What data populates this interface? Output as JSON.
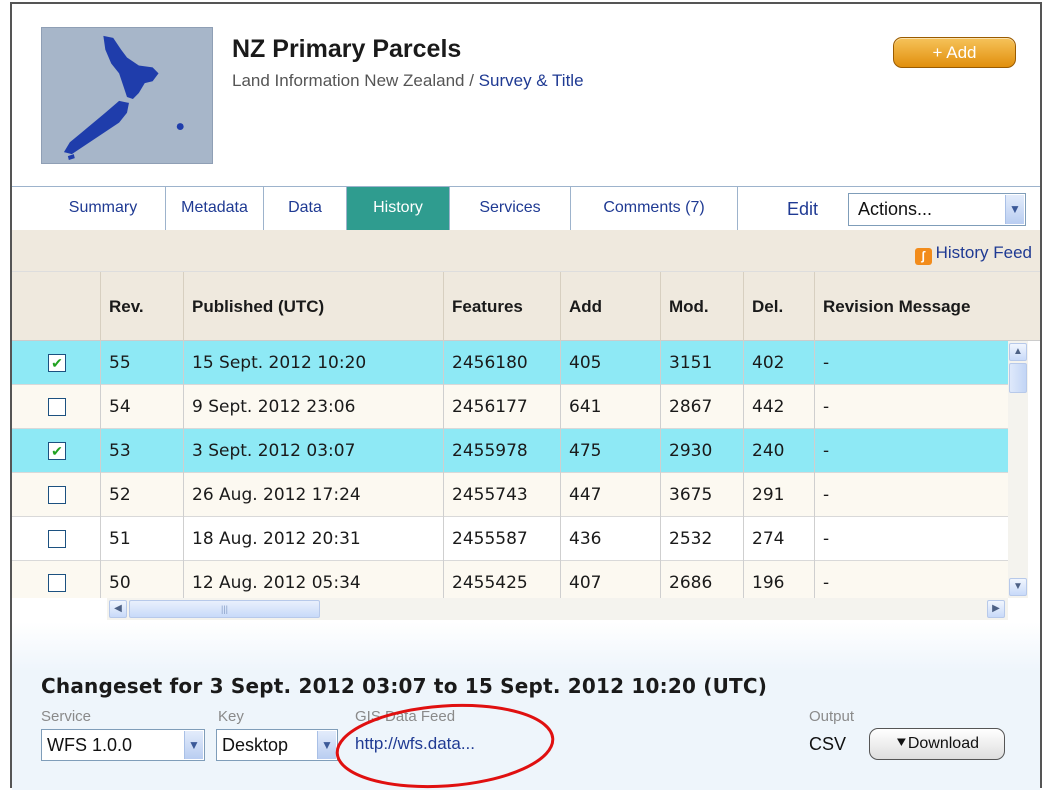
{
  "header": {
    "title": "NZ Primary Parcels",
    "publisher": "Land Information New Zealand",
    "separator": " / ",
    "category": "Survey & Title",
    "add_label": "+ Add",
    "thumbnail_icon": "nz-map-thumbnail"
  },
  "tabs": [
    {
      "label": "Summary",
      "active": false
    },
    {
      "label": "Metadata",
      "active": false
    },
    {
      "label": "Data",
      "active": false
    },
    {
      "label": "History",
      "active": true
    },
    {
      "label": "Services",
      "active": false
    },
    {
      "label": "Comments (7)",
      "active": false
    }
  ],
  "toolbar": {
    "edit_label": "Edit",
    "actions_value": "Actions...",
    "feed_label": "History Feed",
    "feed_icon": "rss-icon"
  },
  "table": {
    "columns": [
      "",
      "Rev.",
      "Published (UTC)",
      "Features",
      "Add",
      "Mod.",
      "Del.",
      "Revision Message"
    ],
    "rows": [
      {
        "checked": true,
        "rev": "55",
        "published": "15 Sept. 2012 10:20",
        "features": "2456180",
        "add": "405",
        "mod": "3151",
        "del": "402",
        "message": "-"
      },
      {
        "checked": false,
        "rev": "54",
        "published": "9 Sept. 2012 23:06",
        "features": "2456177",
        "add": "641",
        "mod": "2867",
        "del": "442",
        "message": "-"
      },
      {
        "checked": true,
        "rev": "53",
        "published": "3 Sept. 2012 03:07",
        "features": "2455978",
        "add": "475",
        "mod": "2930",
        "del": "240",
        "message": "-"
      },
      {
        "checked": false,
        "rev": "52",
        "published": "26 Aug. 2012 17:24",
        "features": "2455743",
        "add": "447",
        "mod": "3675",
        "del": "291",
        "message": "-"
      },
      {
        "checked": false,
        "rev": "51",
        "published": "18 Aug. 2012 20:31",
        "features": "2455587",
        "add": "436",
        "mod": "2532",
        "del": "274",
        "message": "-"
      },
      {
        "checked": false,
        "rev": "50",
        "published": "12 Aug. 2012 05:34",
        "features": "2455425",
        "add": "407",
        "mod": "2686",
        "del": "196",
        "message": "-"
      }
    ]
  },
  "changeset": {
    "title": "Changeset for 3 Sept. 2012 03:07 to 15 Sept. 2012 10:20 (UTC)",
    "service_label": "Service",
    "service_value": "WFS 1.0.0",
    "key_label": "Key",
    "key_value": "Desktop",
    "feed_label": "GIS Data Feed",
    "feed_link": "http://wfs.data...",
    "output_label": "Output",
    "output_value": "CSV",
    "download_label": "Download",
    "download_icon": "download-icon"
  },
  "colors": {
    "selected_row": "#8ee9f5",
    "active_tab": "#2f9c8f",
    "link": "#1f3a93",
    "add_button": "#f0a83a",
    "annotation": "#e01010"
  }
}
